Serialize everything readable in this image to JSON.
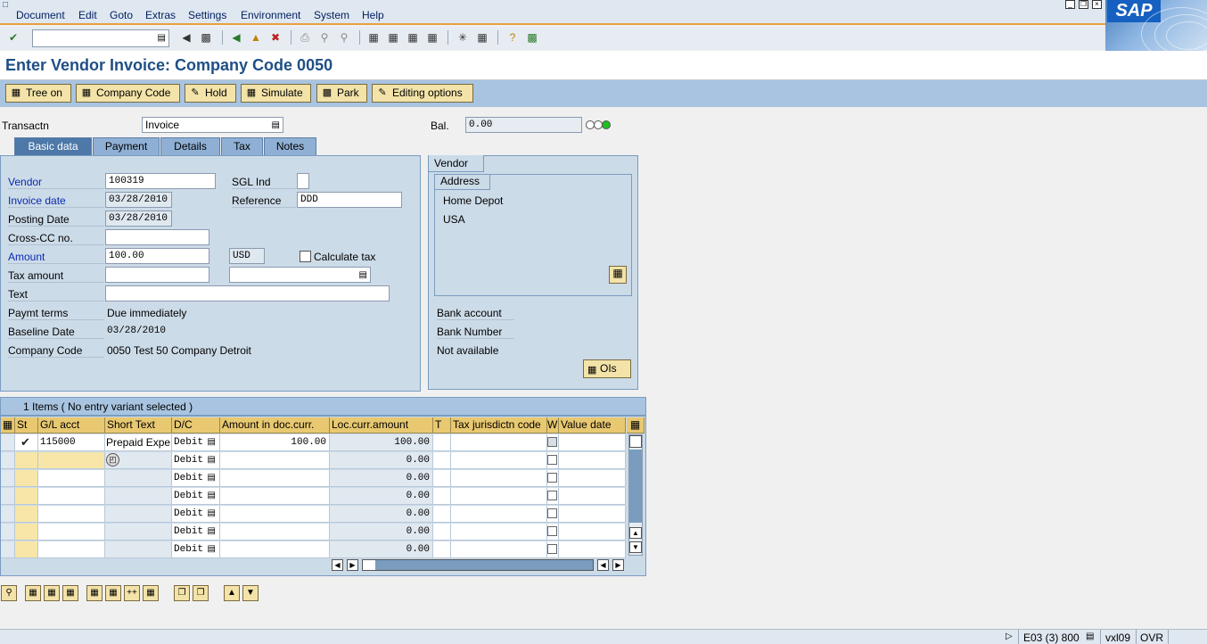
{
  "menu": [
    "Document",
    "Edit",
    "Goto",
    "Extras",
    "Settings",
    "Environment",
    "System",
    "Help"
  ],
  "logo_text": "SAP",
  "title": "Enter Vendor Invoice: Company Code 0050",
  "app_toolbar": {
    "tree_on": "Tree on",
    "company_code": "Company Code",
    "hold": "Hold",
    "simulate": "Simulate",
    "park": "Park",
    "editing_options": "Editing options"
  },
  "header": {
    "transaction_label": "Transactn",
    "transaction_value": "Invoice",
    "balance_label": "Bal.",
    "balance_value": "0.00"
  },
  "tabs": [
    "Basic data",
    "Payment",
    "Details",
    "Tax",
    "Notes"
  ],
  "basic": {
    "vendor_label": "Vendor",
    "vendor_value": "100319",
    "sgl_label": "SGL Ind",
    "invoice_date_label": "Invoice date",
    "invoice_date_value": "03/28/2010",
    "reference_label": "Reference",
    "reference_value": "DDD",
    "posting_date_label": "Posting Date",
    "posting_date_value": "03/28/2010",
    "cross_cc_label": "Cross-CC no.",
    "amount_label": "Amount",
    "amount_value": "100.00",
    "currency_value": "USD",
    "calc_tax_label": "Calculate tax",
    "tax_amount_label": "Tax amount",
    "text_label": "Text",
    "paymt_terms_label": "Paymt terms",
    "paymt_terms_value": "Due immediately",
    "baseline_date_label": "Baseline Date",
    "baseline_date_value": "03/28/2010",
    "company_code_label": "Company Code",
    "company_code_value": "0050 Test 50 Company Detroit"
  },
  "vendor_panel": {
    "tab_label": "Vendor",
    "address_label": "Address",
    "name": "Home Depot",
    "country": "USA",
    "bank_account_label": "Bank account",
    "bank_number_label": "Bank Number",
    "not_available": "Not available",
    "ois_label": "OIs"
  },
  "items": {
    "title": "1 Items ( No entry variant selected )",
    "columns": [
      "St",
      "G/L acct",
      "Short Text",
      "D/C",
      "Amount in doc.curr.",
      "Loc.curr.amount",
      "T",
      "Tax jurisdictn code",
      "W",
      "Value date"
    ],
    "rows": [
      {
        "gl": "115000",
        "short_text": "Prepaid Expe",
        "dc": "Debit",
        "amount": "100.00",
        "loc_amount": "100.00"
      },
      {
        "gl": "",
        "short_text": "",
        "dc": "Debit",
        "amount": "",
        "loc_amount": "0.00"
      },
      {
        "gl": "",
        "short_text": "",
        "dc": "Debit",
        "amount": "",
        "loc_amount": "0.00"
      },
      {
        "gl": "",
        "short_text": "",
        "dc": "Debit",
        "amount": "",
        "loc_amount": "0.00"
      },
      {
        "gl": "",
        "short_text": "",
        "dc": "Debit",
        "amount": "",
        "loc_amount": "0.00"
      },
      {
        "gl": "",
        "short_text": "",
        "dc": "Debit",
        "amount": "",
        "loc_amount": "0.00"
      },
      {
        "gl": "",
        "short_text": "",
        "dc": "Debit",
        "amount": "",
        "loc_amount": "0.00"
      }
    ]
  },
  "statusbar": {
    "system": "E03 (3) 800",
    "server": "vxl09",
    "mode": "OVR"
  },
  "colors": {
    "title": "#1f4f85",
    "menu_accent": "#e8a040",
    "app_toolbar": "#a8c4e0",
    "button": "#f3e3a8"
  }
}
